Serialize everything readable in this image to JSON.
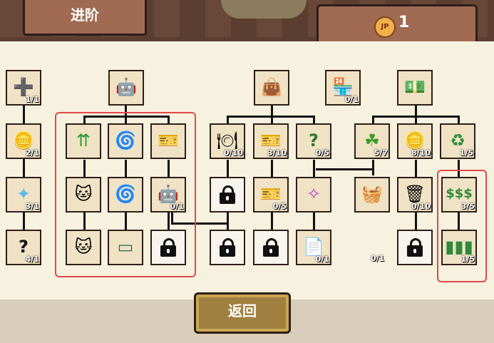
{
  "header": {
    "title": "进阶",
    "currency_icon": "jp-coin-icon",
    "currency_symbol": "JP",
    "currency_count": "1"
  },
  "columns": {
    "col1": [
      {
        "icon": "plus-cards-icon",
        "level": "1/1"
      },
      {
        "icon": "plus-coin-icon",
        "level": "2/1"
      },
      {
        "icon": "sparkle-icon",
        "level": "3/1"
      },
      {
        "icon": "question-mark-icon",
        "level": "4/1"
      }
    ],
    "col2_parent": {
      "icon": "robot-icon",
      "level": ""
    },
    "col2_grid": [
      {
        "icon": "upgrade-arrows-bolt-icon",
        "level": ""
      },
      {
        "icon": "desk-fan-battery-icon",
        "level": ""
      },
      {
        "icon": "ticket-star-icon",
        "level": ""
      },
      {
        "icon": "lucky-cat-coin-icon",
        "level": ""
      },
      {
        "icon": "desk-fan-icon",
        "level": ""
      },
      {
        "icon": "robot-head-icon",
        "level": "0/1"
      },
      {
        "icon": "lucky-cat-trash-icon",
        "level": ""
      },
      {
        "icon": "chalkboard-icon",
        "level": ""
      },
      {
        "icon": "lock-icon",
        "level": ""
      }
    ],
    "col3_parent": {
      "icon": "crown-bag-icon",
      "level": ""
    },
    "col3": [
      {
        "icon": "plate-sparkle-icon",
        "level": "0/10"
      },
      {
        "icon": "ticket-icon",
        "level": "3/10"
      },
      {
        "icon": "question-card-icon",
        "level": "0/5"
      },
      {
        "icon": "lock-icon",
        "level": ""
      },
      {
        "icon": "ticket-icon",
        "level": "0/5"
      },
      {
        "icon": "magic-wand-icon",
        "level": ""
      },
      {
        "icon": "lock-icon",
        "level": ""
      },
      {
        "icon": "lock-icon",
        "level": ""
      },
      {
        "icon": "loan-paper-icon",
        "level": "0/1"
      }
    ],
    "col4_parent": {
      "icon": "shop-stall-icon",
      "level": "0/1"
    },
    "col5_parent": {
      "icon": "jp-cash-icon",
      "level": ""
    },
    "col5": [
      {
        "icon": "jack-clover-icon",
        "level": "5/7"
      },
      {
        "icon": "coin-stack-icon",
        "level": "8/10"
      },
      {
        "icon": "recycle-icon",
        "level": "1/5"
      },
      {
        "icon": "basket-icon",
        "level": ""
      },
      {
        "icon": "trash-can-icon",
        "level": "0/10"
      },
      {
        "icon": "dollar-bill-icon",
        "level": "3/5"
      },
      {
        "icon": "lock-icon",
        "level": ""
      },
      {
        "icon": "cash-battery-icon",
        "level": "1/5"
      }
    ],
    "loose_level": "0/1"
  },
  "footer": {
    "back_label": "返回"
  },
  "colors": {
    "highlight": "#e04a4a",
    "tile_bg": "#f0e2c4",
    "border": "#2e1f18",
    "button": "#a08040"
  }
}
